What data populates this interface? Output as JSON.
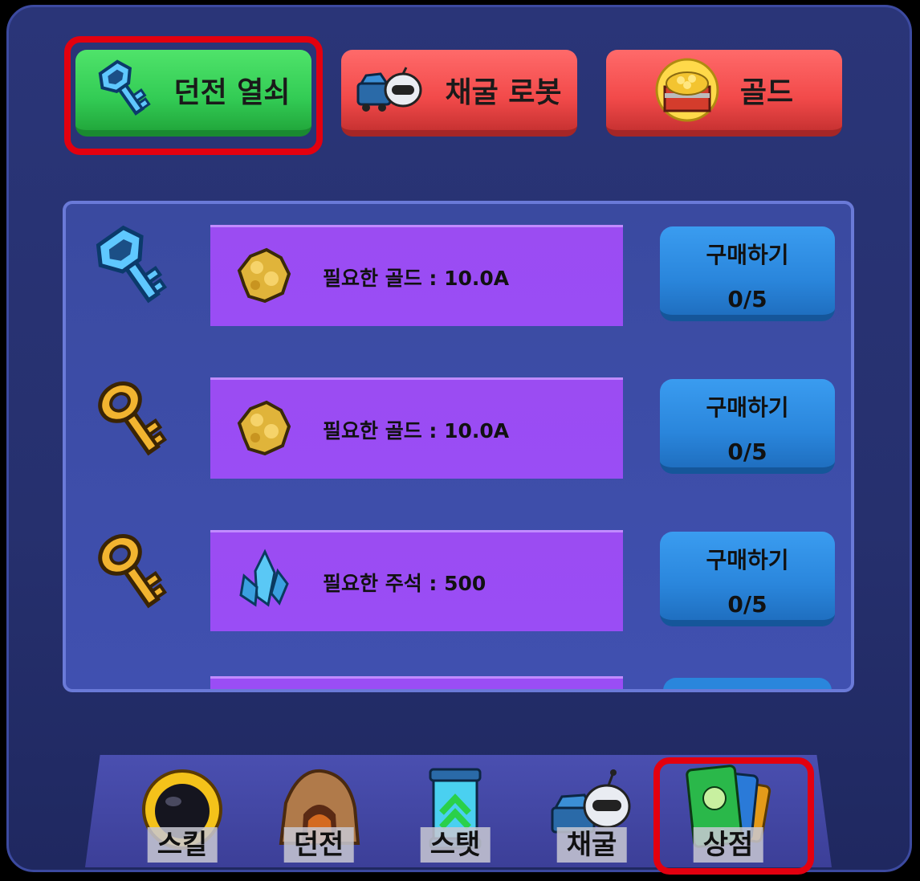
{
  "tabs": [
    {
      "label": "던전 열쇠",
      "icon": "blue-key-icon",
      "selected": true
    },
    {
      "label": "채굴 로봇",
      "icon": "mining-robot-icon",
      "selected": false
    },
    {
      "label": "골드",
      "icon": "gold-chest-icon",
      "selected": false
    }
  ],
  "shop_items": [
    {
      "key_icon": "blue-key-icon",
      "cost_icon": "gold-nugget-icon",
      "cost_text": "필요한 골드 : 10.0A",
      "buy_label": "구매하기",
      "count": "0/5"
    },
    {
      "key_icon": "gold-key-icon",
      "cost_icon": "gold-nugget-icon",
      "cost_text": "필요한 골드 : 10.0A",
      "buy_label": "구매하기",
      "count": "0/5"
    },
    {
      "key_icon": "gold-key-icon",
      "cost_icon": "blue-crystal-icon",
      "cost_text": "필요한 주석 : 500",
      "buy_label": "구매하기",
      "count": "0/5"
    }
  ],
  "nav": [
    {
      "label": "스킬",
      "icon": "helmet-icon",
      "selected": false
    },
    {
      "label": "던전",
      "icon": "cave-icon",
      "selected": false
    },
    {
      "label": "스탯",
      "icon": "stat-capsule-icon",
      "selected": false
    },
    {
      "label": "채굴",
      "icon": "mining-robot-icon",
      "selected": false
    },
    {
      "label": "상점",
      "icon": "shop-cards-icon",
      "selected": true
    }
  ],
  "colors": {
    "highlight": "#e3000f",
    "tab_selected": "#33cc55",
    "tab_normal": "#f24a4a",
    "cost_bg": "#9a4df5",
    "buy_bg": "#2a86dc"
  }
}
